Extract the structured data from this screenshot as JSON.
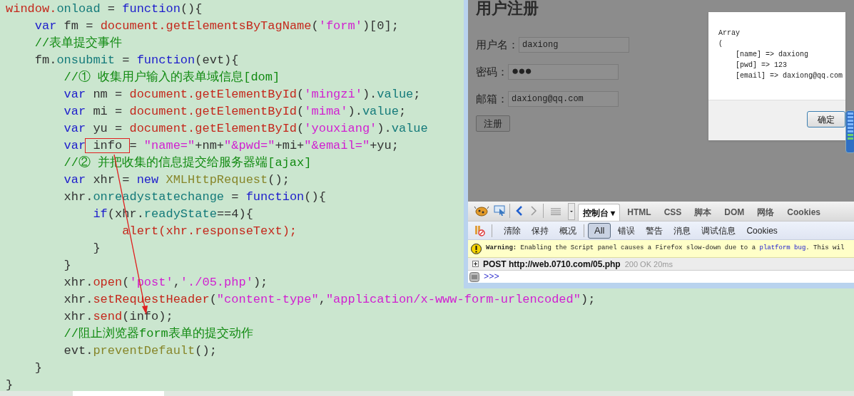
{
  "code": {
    "lines": [
      [
        {
          "text": "window.",
          "kind": "obj"
        },
        {
          "text": "onload",
          "kind": "prop"
        },
        {
          "text": " = ",
          "kind": "plain"
        },
        {
          "text": "function",
          "kind": "kw"
        },
        {
          "text": "(){",
          "kind": "plain"
        }
      ],
      [
        {
          "text": "    var",
          "kind": "kw"
        },
        {
          "text": " fm = ",
          "kind": "plain"
        },
        {
          "text": "document.getElementsByTagName",
          "kind": "obj"
        },
        {
          "text": "(",
          "kind": "plain"
        },
        {
          "text": "'form'",
          "kind": "str"
        },
        {
          "text": ")[0];",
          "kind": "plain"
        }
      ],
      [
        {
          "text": "    //表单提交事件",
          "kind": "cmt"
        }
      ],
      [
        {
          "text": "    fm.",
          "kind": "plain"
        },
        {
          "text": "onsubmit",
          "kind": "prop"
        },
        {
          "text": " = ",
          "kind": "plain"
        },
        {
          "text": "function",
          "kind": "kw"
        },
        {
          "text": "(evt){",
          "kind": "plain"
        }
      ],
      [
        {
          "text": "        //① 收集用户输入的表单域信息[dom]",
          "kind": "cmt"
        }
      ],
      [
        {
          "text": "        var",
          "kind": "kw"
        },
        {
          "text": " nm = ",
          "kind": "plain"
        },
        {
          "text": "document.getElementById",
          "kind": "obj"
        },
        {
          "text": "(",
          "kind": "plain"
        },
        {
          "text": "'mingzi'",
          "kind": "str"
        },
        {
          "text": ").",
          "kind": "plain"
        },
        {
          "text": "value",
          "kind": "prop"
        },
        {
          "text": ";",
          "kind": "plain"
        }
      ],
      [
        {
          "text": "        var",
          "kind": "kw"
        },
        {
          "text": " mi = ",
          "kind": "plain"
        },
        {
          "text": "document.getElementById",
          "kind": "obj"
        },
        {
          "text": "(",
          "kind": "plain"
        },
        {
          "text": "'mima'",
          "kind": "str"
        },
        {
          "text": ").",
          "kind": "plain"
        },
        {
          "text": "value",
          "kind": "prop"
        },
        {
          "text": ";",
          "kind": "plain"
        }
      ],
      [
        {
          "text": "        var",
          "kind": "kw"
        },
        {
          "text": " yu = ",
          "kind": "plain"
        },
        {
          "text": "document.getElementById",
          "kind": "obj"
        },
        {
          "text": "(",
          "kind": "plain"
        },
        {
          "text": "'youxiang'",
          "kind": "str"
        },
        {
          "text": ").",
          "kind": "plain"
        },
        {
          "text": "value",
          "kind": "prop"
        }
      ],
      [
        {
          "text": "        var",
          "kind": "kw"
        },
        {
          "text": " info ",
          "kind": "plain",
          "highlighted": true
        },
        {
          "text": "= ",
          "kind": "plain"
        },
        {
          "text": "\"name=\"",
          "kind": "str"
        },
        {
          "text": "+nm+",
          "kind": "plain"
        },
        {
          "text": "\"&pwd=\"",
          "kind": "str"
        },
        {
          "text": "+mi+",
          "kind": "plain"
        },
        {
          "text": "\"&email=\"",
          "kind": "str"
        },
        {
          "text": "+yu;",
          "kind": "plain"
        }
      ],
      [
        {
          "text": "        //② 并把收集的信息提交给服务器端[ajax]",
          "kind": "cmt"
        }
      ],
      [
        {
          "text": "        var",
          "kind": "kw"
        },
        {
          "text": " xhr = ",
          "kind": "plain"
        },
        {
          "text": "new ",
          "kind": "kw"
        },
        {
          "text": "XMLHttpRequest",
          "kind": "cls"
        },
        {
          "text": "();",
          "kind": "plain"
        }
      ],
      [
        {
          "text": "        xhr.",
          "kind": "plain"
        },
        {
          "text": "onreadystatechange",
          "kind": "prop"
        },
        {
          "text": " = ",
          "kind": "plain"
        },
        {
          "text": "function",
          "kind": "kw"
        },
        {
          "text": "(){",
          "kind": "plain"
        }
      ],
      [
        {
          "text": "            if",
          "kind": "kw"
        },
        {
          "text": "(xhr.",
          "kind": "plain"
        },
        {
          "text": "readyState",
          "kind": "prop"
        },
        {
          "text": "==4){",
          "kind": "plain"
        }
      ],
      [
        {
          "text": "                alert(xhr.responseText);",
          "kind": "obj"
        }
      ],
      [
        {
          "text": "            }",
          "kind": "plain"
        }
      ],
      [
        {
          "text": "        }",
          "kind": "plain"
        }
      ],
      [
        {
          "text": "        xhr.",
          "kind": "plain"
        },
        {
          "text": "open",
          "kind": "obj"
        },
        {
          "text": "(",
          "kind": "plain"
        },
        {
          "text": "'post'",
          "kind": "str"
        },
        {
          "text": ",",
          "kind": "plain"
        },
        {
          "text": "'./05.php'",
          "kind": "str"
        },
        {
          "text": ");",
          "kind": "plain"
        }
      ],
      [
        {
          "text": "        xhr.",
          "kind": "plain"
        },
        {
          "text": "setRequestHeader",
          "kind": "obj"
        },
        {
          "text": "(",
          "kind": "plain"
        },
        {
          "text": "\"content-type\"",
          "kind": "str"
        },
        {
          "text": ",",
          "kind": "plain"
        },
        {
          "text": "\"application/x-www-form-urlencoded\"",
          "kind": "str"
        },
        {
          "text": ");",
          "kind": "plain"
        }
      ],
      [
        {
          "text": "        xhr.",
          "kind": "plain"
        },
        {
          "text": "send",
          "kind": "obj"
        },
        {
          "text": "(info);",
          "kind": "plain"
        }
      ],
      [
        {
          "text": "        //阻止浏览器form表单的提交动作",
          "kind": "cmt"
        }
      ],
      [
        {
          "text": "        evt.",
          "kind": "plain"
        },
        {
          "text": "preventDefault",
          "kind": "cls"
        },
        {
          "text": "();",
          "kind": "plain"
        }
      ],
      [
        {
          "text": "    }",
          "kind": "plain"
        }
      ],
      [
        {
          "text": "}",
          "kind": "plain"
        }
      ]
    ]
  },
  "browser": {
    "page": {
      "heading": "用户注册",
      "fields": [
        {
          "label": "用户名：",
          "value": "daxiong"
        },
        {
          "label": "密码：",
          "value": "●●●"
        },
        {
          "label": "邮箱：",
          "value": "daxiong@qq.com"
        }
      ],
      "submit": "注册"
    },
    "dialog": {
      "lines": [
        "Array",
        "(",
        "    [name] => daxiong",
        "    [pwd] => 123",
        "    [email] => daxiong@qq.com"
      ],
      "button": "确定"
    },
    "firebug": {
      "tabs": [
        {
          "label": "控制台 ▾",
          "selected": true
        },
        {
          "label": "HTML",
          "selected": false
        },
        {
          "label": "CSS",
          "selected": false
        },
        {
          "label": "脚本",
          "selected": false
        },
        {
          "label": "DOM",
          "selected": false
        },
        {
          "label": "网络",
          "selected": false
        },
        {
          "label": "Cookies",
          "selected": false
        }
      ],
      "actions": [
        "清除",
        "保持",
        "概况"
      ],
      "filters": [
        {
          "label": "All",
          "selected": true
        },
        {
          "label": "错误",
          "selected": false
        },
        {
          "label": "警告",
          "selected": false
        },
        {
          "label": "消息",
          "selected": false
        },
        {
          "label": "调试信息",
          "selected": false
        },
        {
          "label": "Cookies",
          "selected": false
        }
      ],
      "warning": {
        "before": "**Warning:** Enabling the Script panel causes a Firefox slow-down due to a ",
        "link": "platform bug",
        "after": ". This wil"
      },
      "log": {
        "request": "POST http://web.0710.com/05.php",
        "status": "200 OK 20ms"
      },
      "prompt": ">>>"
    }
  }
}
